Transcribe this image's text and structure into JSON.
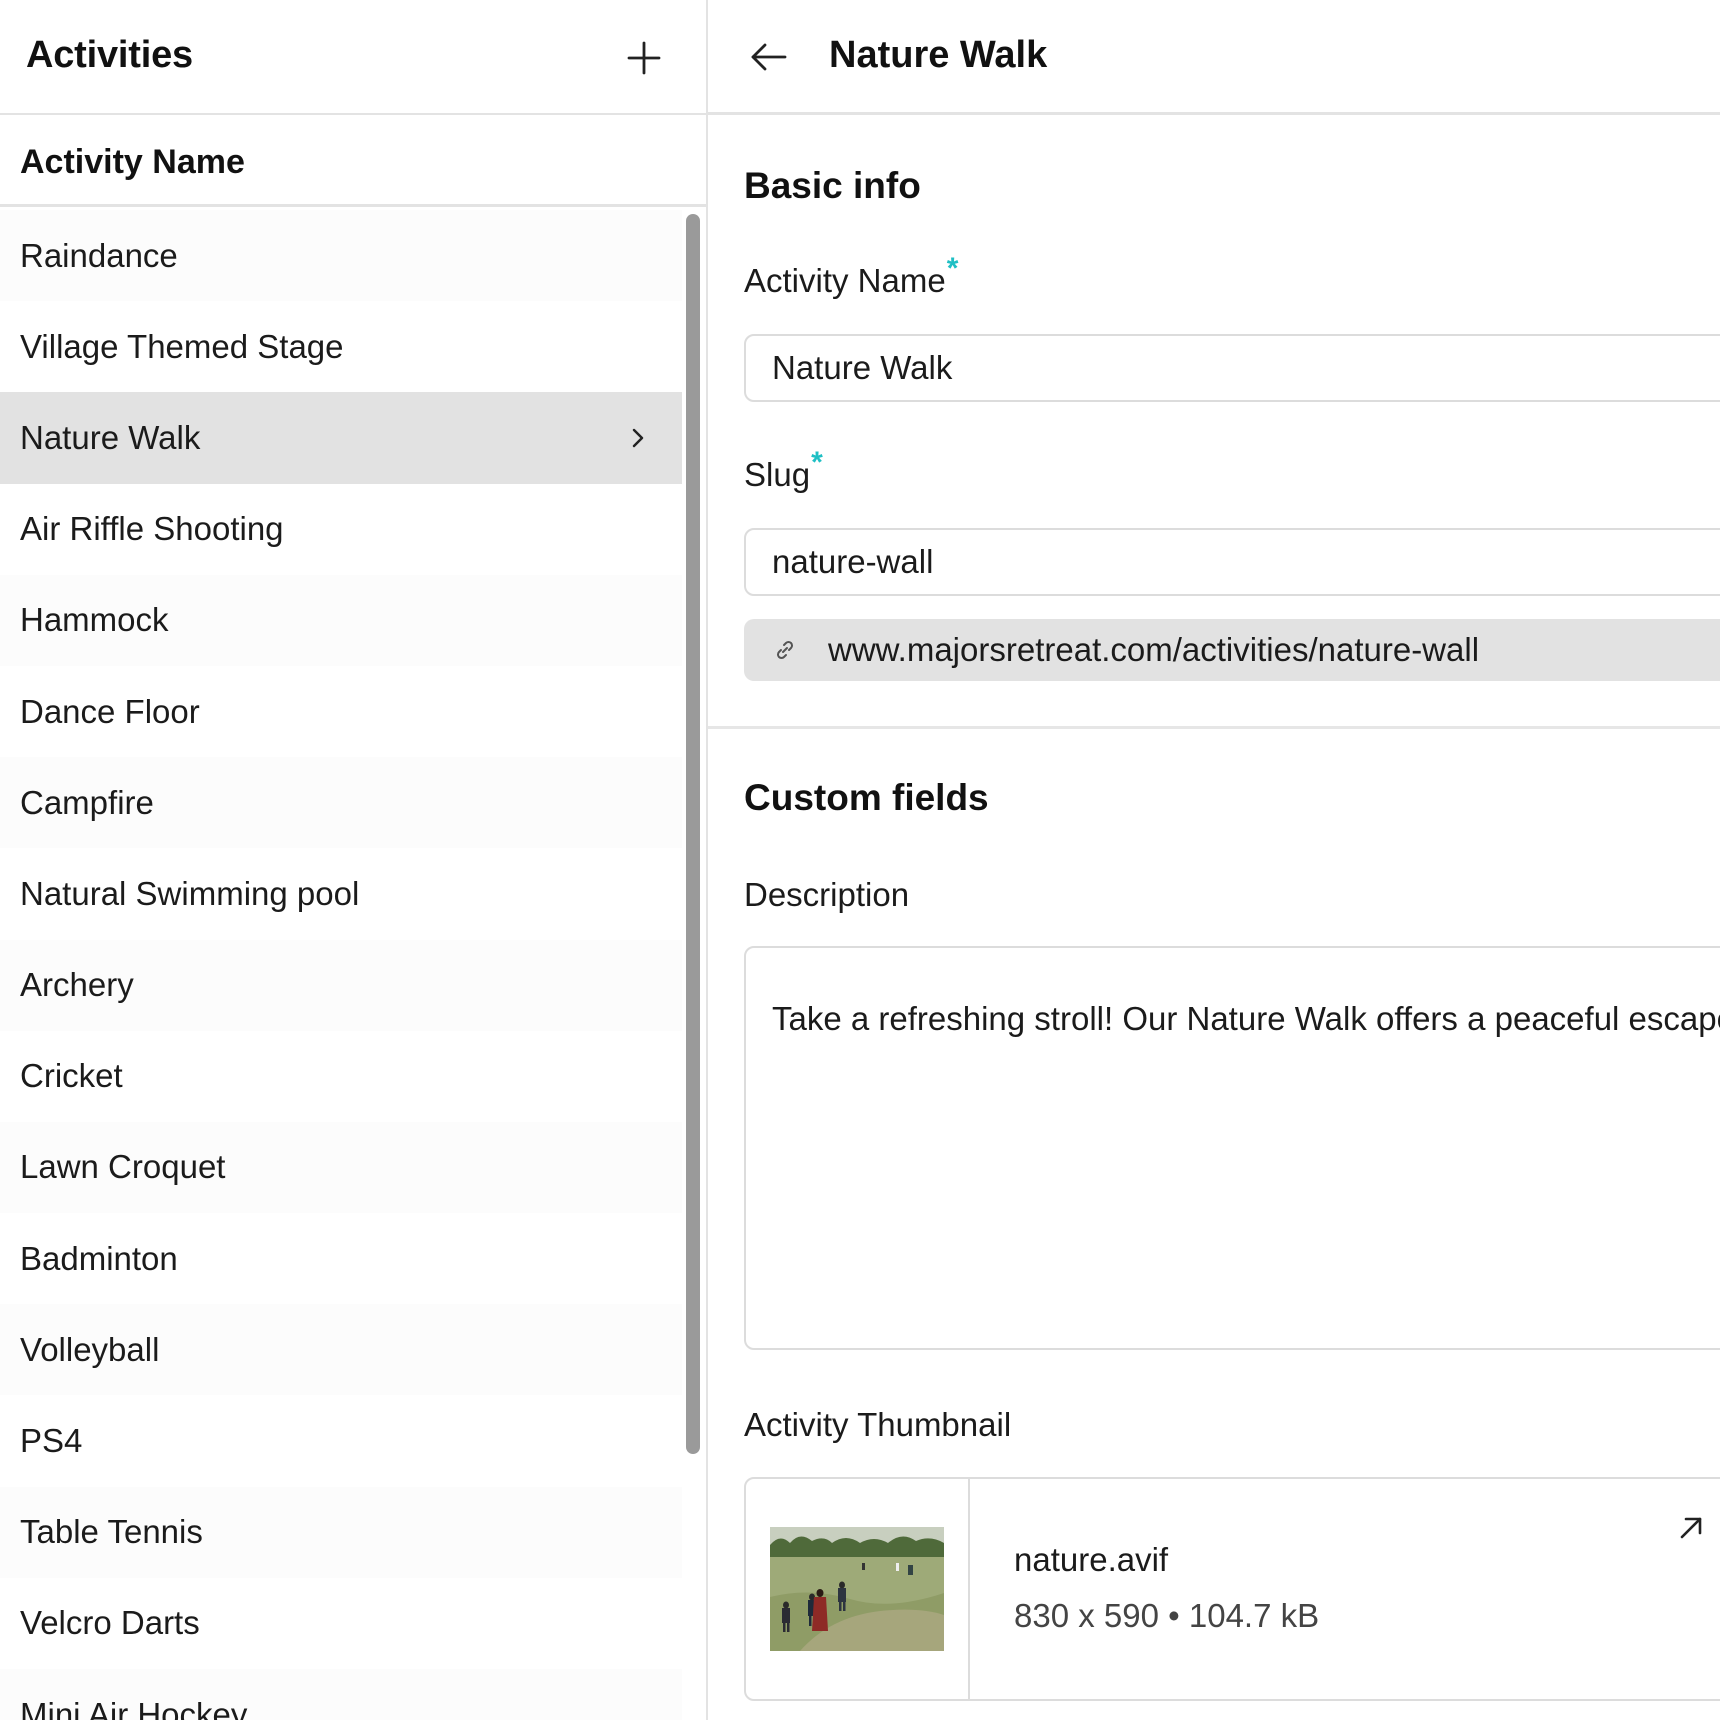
{
  "sidebar": {
    "title": "Activities",
    "add_icon": "plus-icon",
    "column_header": "Activity Name",
    "items": [
      {
        "label": "Raindance"
      },
      {
        "label": "Village Themed Stage"
      },
      {
        "label": "Nature Walk",
        "selected": true
      },
      {
        "label": "Air Riffle Shooting"
      },
      {
        "label": "Hammock"
      },
      {
        "label": "Dance Floor"
      },
      {
        "label": "Campfire"
      },
      {
        "label": "Natural Swimming pool"
      },
      {
        "label": "Archery"
      },
      {
        "label": "Cricket"
      },
      {
        "label": "Lawn Croquet"
      },
      {
        "label": "Badminton"
      },
      {
        "label": "Volleyball"
      },
      {
        "label": "PS4"
      },
      {
        "label": "Table Tennis"
      },
      {
        "label": "Velcro Darts"
      },
      {
        "label": "Mini Air Hockey"
      }
    ]
  },
  "detail": {
    "title": "Nature Walk",
    "back_icon": "arrow-left-icon",
    "basic_info": {
      "section_title": "Basic info",
      "name_label": "Activity Name",
      "name_value": "Nature Walk",
      "slug_label": "Slug",
      "slug_value": "nature-wall",
      "url_icon": "link-icon",
      "url_prefix": "www.majorsretreat.com/activities/",
      "url_slug": "nature-wall",
      "required_marker": "*"
    },
    "custom_fields": {
      "section_title": "Custom fields",
      "description_label": "Description",
      "description_value": "Take a refreshing stroll! Our Nature Walk offers a peaceful escape",
      "thumbnail_label": "Activity Thumbnail",
      "thumbnail": {
        "file_name": "nature.avif",
        "dimensions": "830 x 590",
        "separator": "•",
        "file_size": "104.7 kB",
        "open_icon": "arrow-up-right-icon"
      }
    }
  },
  "colors": {
    "accent_required": "#1fbfc4",
    "selected_row": "#e2e2e2",
    "url_bar": "#e2e2e2",
    "border": "#dcdcdc"
  }
}
